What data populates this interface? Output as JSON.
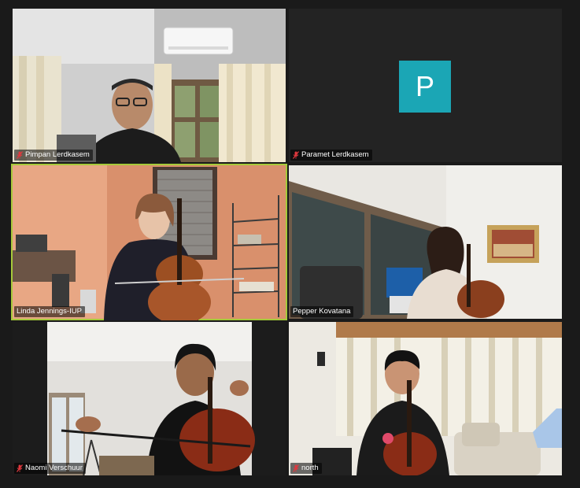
{
  "participants": [
    {
      "name": "Pimpan Lerdkasem",
      "muted": true,
      "video": true
    },
    {
      "name": "Paramet Lerdkasem",
      "muted": true,
      "video": false,
      "avatar_letter": "P"
    },
    {
      "name": "Linda Jennings-IUP",
      "muted": false,
      "video": true,
      "active_speaker": true
    },
    {
      "name": "Pepper Kovatana",
      "muted": false,
      "video": true
    },
    {
      "name": "Naomi Verschuur",
      "muted": true,
      "video": true
    },
    {
      "name": "north",
      "muted": true,
      "video": true
    }
  ],
  "colors": {
    "background": "#1a1a1a",
    "tile_background": "#232323",
    "active_speaker_border": "#a6c93a",
    "avatar_color": "#1ba6b5",
    "muted_icon": "#e0383e"
  }
}
